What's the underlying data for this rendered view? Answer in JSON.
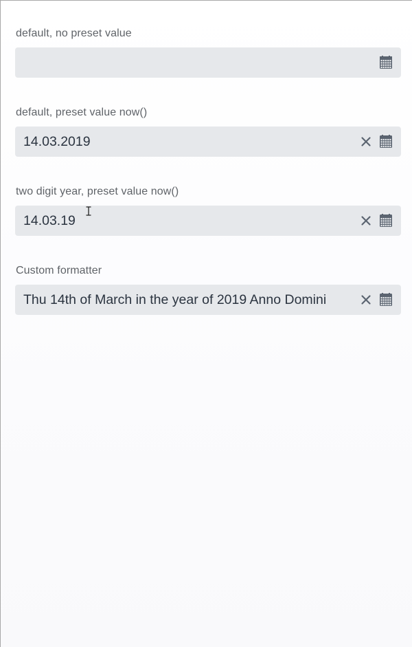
{
  "fields": [
    {
      "label": "default, no preset value",
      "value": "",
      "has_clear": false
    },
    {
      "label": "default, preset value now()",
      "value": "14.03.2019",
      "has_clear": true
    },
    {
      "label": "two digit year, preset value now()",
      "value": "14.03.19",
      "has_clear": true
    },
    {
      "label": "Custom formatter",
      "value": "Thu 14th of March in the year of 2019 Anno Domini",
      "has_clear": true
    }
  ],
  "icons": {
    "clear": "close-icon",
    "calendar": "calendar-icon",
    "mouse_cursor": "text-cursor-icon"
  },
  "colors": {
    "field_background": "#e6e8eb",
    "label_text": "#5f6368",
    "value_text": "#2b3440",
    "icon": "#5b6470"
  }
}
